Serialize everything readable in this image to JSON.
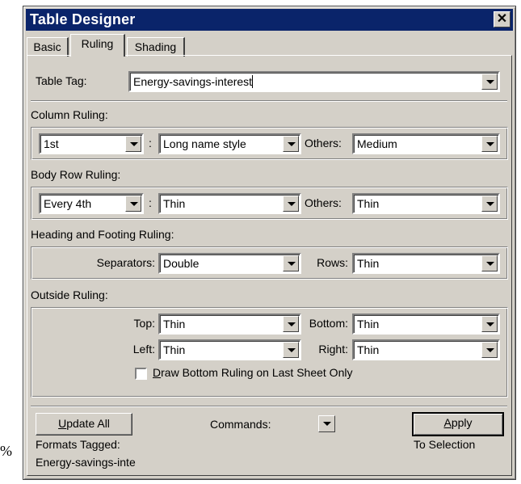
{
  "background_text": "%",
  "window": {
    "title": "Table Designer"
  },
  "tabs": [
    {
      "label": "Basic"
    },
    {
      "label": "Ruling"
    },
    {
      "label": "Shading"
    }
  ],
  "table_tag": {
    "label": "Table Tag:",
    "value": "Energy-savings-interest"
  },
  "column_ruling": {
    "heading": "Column Ruling:",
    "column_select": "1st",
    "colon": ":",
    "style_select": "Long name style",
    "others_label": "Others:",
    "others_select": "Medium"
  },
  "body_row_ruling": {
    "heading": "Body Row Ruling:",
    "row_select": "Every 4th",
    "colon": ":",
    "style_select": "Thin",
    "others_label": "Others:",
    "others_select": "Thin"
  },
  "heading_footing_ruling": {
    "heading": "Heading and Footing Ruling:",
    "separators_label": "Separators:",
    "separators_select": "Double",
    "rows_label": "Rows:",
    "rows_select": "Thin"
  },
  "outside_ruling": {
    "heading": "Outside Ruling:",
    "top_label": "Top:",
    "top_select": "Thin",
    "bottom_label": "Bottom:",
    "bottom_select": "Thin",
    "left_label": "Left:",
    "left_select": "Thin",
    "right_label": "Right:",
    "right_select": "Thin",
    "checkbox_key": "D",
    "checkbox_rest": "raw Bottom Ruling on Last Sheet Only",
    "checkbox_checked": false
  },
  "footer": {
    "update_key": "U",
    "update_rest": "pdate All",
    "commands_label": "Commands:",
    "apply_key": "A",
    "apply_rest": "pply",
    "formats_tagged_label": "Formats Tagged:",
    "formats_tagged_value": "Energy-savings-inte",
    "to_selection": "To Selection"
  }
}
